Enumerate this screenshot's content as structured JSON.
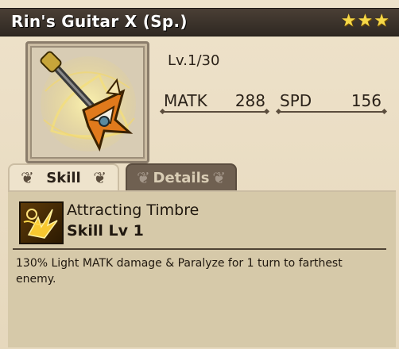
{
  "item": {
    "name": "Rin's Guitar X (Sp.)",
    "rarity_stars": 3,
    "star_glyph": "★",
    "level_text": "Lv.1/30",
    "icon": "guitar-weapon-icon"
  },
  "stats": {
    "matk": {
      "label": "MATK",
      "value": "288"
    },
    "spd": {
      "label": "SPD",
      "value": "156"
    }
  },
  "tabs": {
    "skill": {
      "label": "Skill",
      "active": true
    },
    "details": {
      "label": "Details",
      "active": false
    }
  },
  "skill": {
    "icon": "light-burst-skill-icon",
    "name": "Attracting Timbre",
    "level": "Skill Lv 1",
    "description": "130% Light MATK damage & Paralyze for 1 turn to farthest enemy."
  },
  "colors": {
    "title_bar": "#2f2822",
    "star": "#f6d848",
    "panel_bg": "#e6d8bd",
    "tab_inactive": "#6f6051",
    "skill_panel": "#d6c9a9"
  }
}
